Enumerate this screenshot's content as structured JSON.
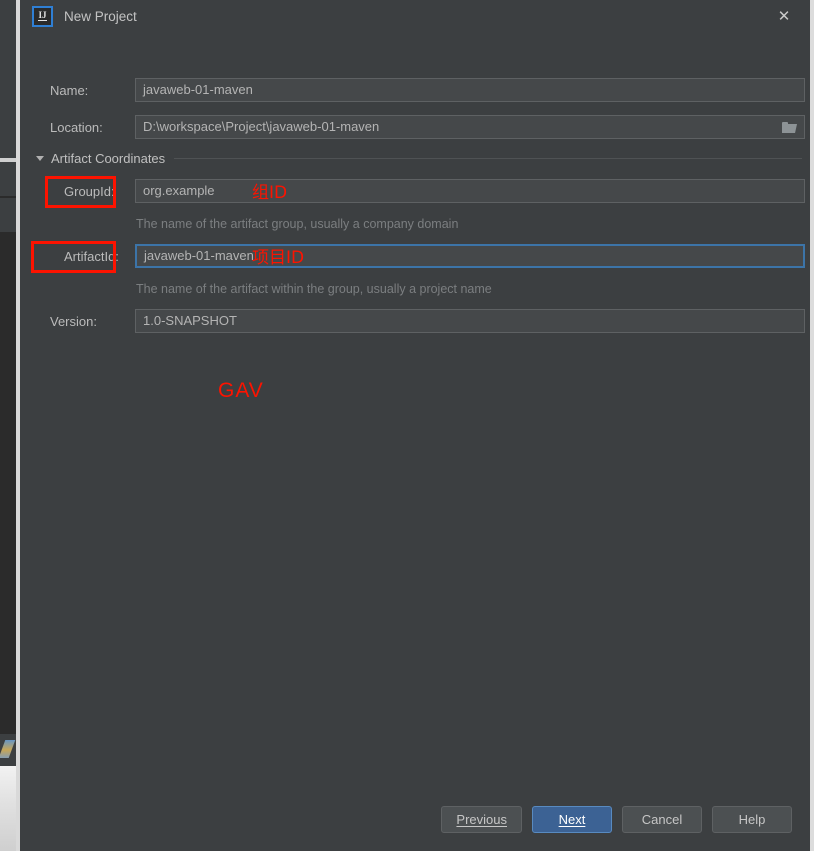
{
  "window": {
    "title": "New Project",
    "app_icon": "intellij-idea-icon",
    "close_icon": "close-icon"
  },
  "form": {
    "name": {
      "label": "Name:",
      "value": "javaweb-01-maven"
    },
    "location": {
      "label": "Location:",
      "value": "D:\\workspace\\Project\\javaweb-01-maven",
      "browse_icon": "folder-icon"
    },
    "section": {
      "label": "Artifact Coordinates",
      "expander_icon": "chevron-down-icon"
    },
    "group_id": {
      "label": "GroupId:",
      "value": "org.example",
      "hint": "The name of the artifact group, usually a company domain"
    },
    "artifact_id": {
      "label": "ArtifactId:",
      "value": "javaweb-01-maven",
      "hint": "The name of the artifact within the group, usually a project name"
    },
    "version": {
      "label": "Version:",
      "value": "1.0-SNAPSHOT"
    }
  },
  "annotations": {
    "group_id_note": "组ID",
    "artifact_id_note": "项目ID",
    "gav_note": "GAV",
    "color": "#fd1300"
  },
  "buttons": {
    "previous": "Previous",
    "next": "Next",
    "cancel": "Cancel",
    "help": "Help",
    "primary_color": "#3c6294"
  }
}
